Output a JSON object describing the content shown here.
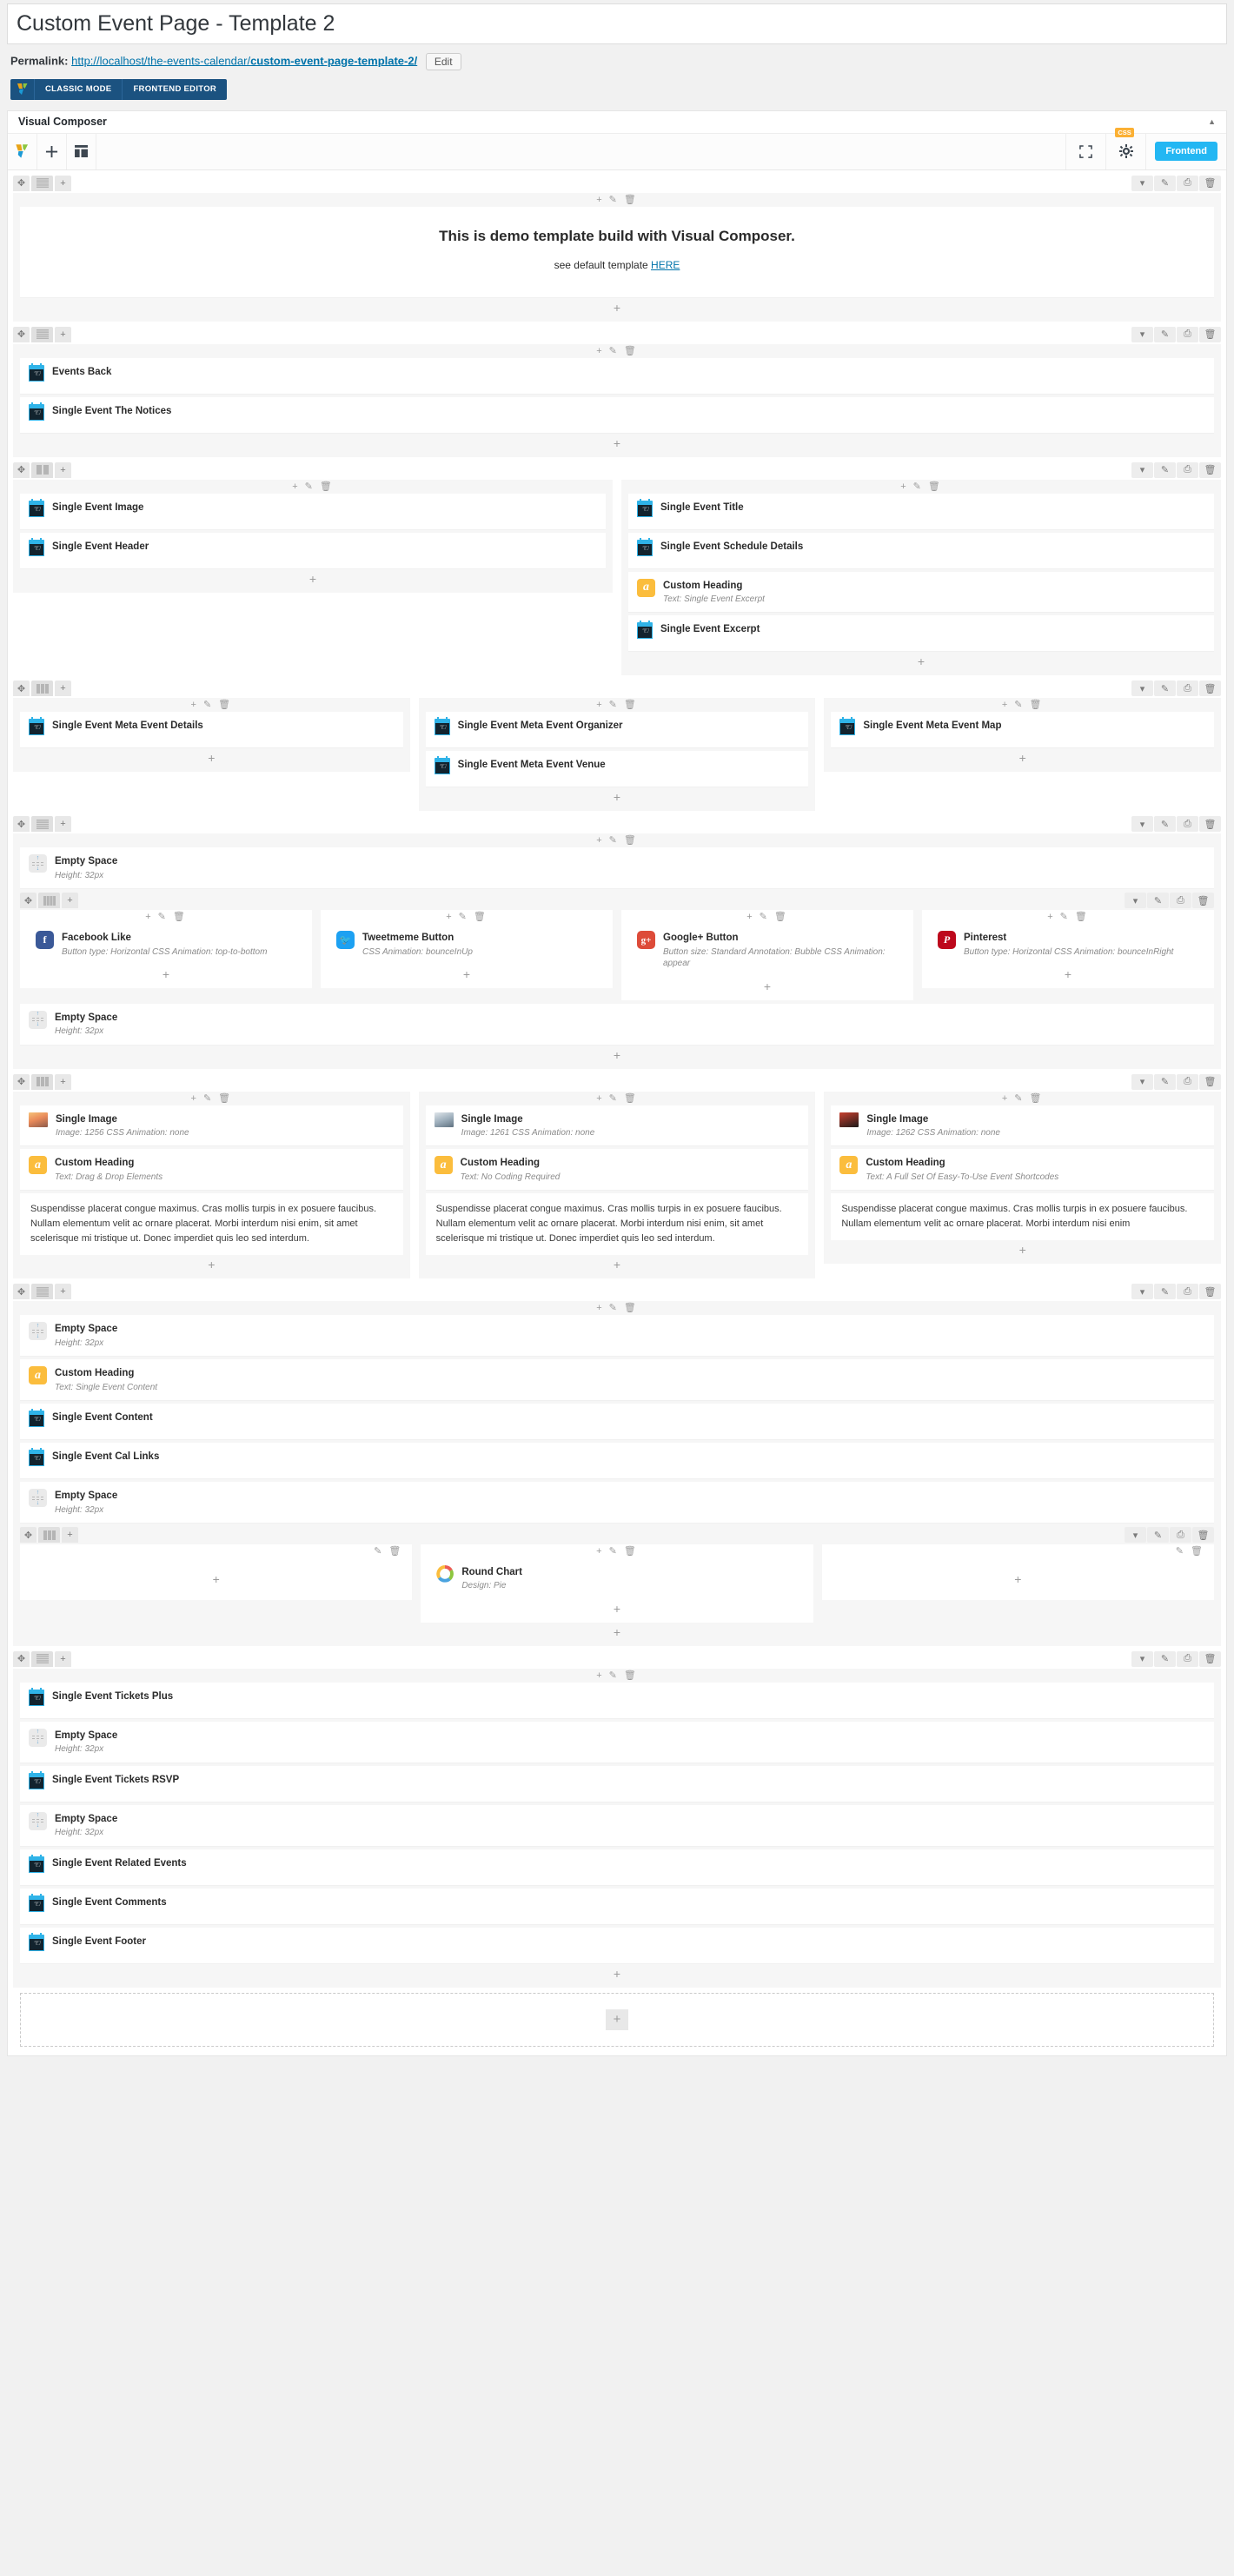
{
  "page": {
    "title": "Custom Event Page - Template 2",
    "permalink_label": "Permalink:",
    "permalink_base": "http://localhost/the-events-calendar/",
    "permalink_slug": "custom-event-page-template-2/",
    "edit_button": "Edit"
  },
  "modebar": {
    "classic": "CLASSIC MODE",
    "frontend": "FRONTEND EDITOR"
  },
  "vc": {
    "panel_title": "Visual Composer",
    "css_badge": "CSS",
    "frontend_button": "Frontend",
    "icons": {
      "logo": "visual-composer-logo-icon",
      "add": "plus-icon",
      "templates": "layout-templates-icon",
      "fullscreen": "fullscreen-icon",
      "settings": "gear-icon"
    }
  },
  "rows": [
    {
      "name": "row-intro",
      "layout": "1-column",
      "columns": [
        {
          "elements": [
            {
              "kind": "text",
              "heading": "This is demo template build with Visual Composer.",
              "sub_prefix": "see default template ",
              "link": "HERE"
            }
          ]
        }
      ]
    },
    {
      "name": "row-events-back",
      "layout": "1-column",
      "columns": [
        {
          "elements": [
            {
              "kind": "calendar",
              "title": "Events Back",
              "sub": ""
            },
            {
              "kind": "calendar",
              "title": "Single Event The Notices",
              "sub": ""
            }
          ]
        }
      ]
    },
    {
      "name": "row-image-title",
      "layout": "2-column",
      "columns": [
        {
          "elements": [
            {
              "kind": "calendar",
              "title": "Single Event Image",
              "sub": ""
            },
            {
              "kind": "calendar",
              "title": "Single Event Header",
              "sub": ""
            }
          ]
        },
        {
          "elements": [
            {
              "kind": "calendar",
              "title": "Single Event Title",
              "sub": ""
            },
            {
              "kind": "calendar",
              "title": "Single Event Schedule Details",
              "sub": ""
            },
            {
              "kind": "heading",
              "title": "Custom Heading",
              "sub": "Text: Single Event Excerpt"
            },
            {
              "kind": "calendar",
              "title": "Single Event Excerpt",
              "sub": ""
            }
          ]
        }
      ]
    },
    {
      "name": "row-meta",
      "layout": "3-column",
      "columns": [
        {
          "elements": [
            {
              "kind": "calendar",
              "title": "Single Event Meta Event Details",
              "sub": ""
            }
          ]
        },
        {
          "elements": [
            {
              "kind": "calendar",
              "title": "Single Event Meta Event Organizer",
              "sub": ""
            },
            {
              "kind": "calendar",
              "title": "Single Event Meta Event Venue",
              "sub": ""
            }
          ]
        },
        {
          "elements": [
            {
              "kind": "calendar",
              "title": "Single Event Meta Event Map",
              "sub": ""
            }
          ]
        }
      ]
    },
    {
      "name": "row-social",
      "layout": "1-column-nested",
      "top_elements": [
        {
          "kind": "space",
          "title": "Empty Space",
          "sub": "Height: 32px"
        }
      ],
      "nested_columns": [
        {
          "elements": [
            {
              "kind": "facebook",
              "title": "Facebook Like",
              "sub": "Button type: Horizontal  CSS Animation: top-to-bottom"
            }
          ]
        },
        {
          "elements": [
            {
              "kind": "twitter",
              "title": "Tweetmeme Button",
              "sub": "CSS Animation: bounceInUp"
            }
          ]
        },
        {
          "elements": [
            {
              "kind": "googleplus",
              "title": "Google+ Button",
              "sub": "Button size: Standard  Annotation: Bubble  CSS Animation: appear"
            }
          ]
        },
        {
          "elements": [
            {
              "kind": "pinterest",
              "title": "Pinterest",
              "sub": "Button type: Horizontal  CSS Animation: bounceInRight"
            }
          ]
        }
      ],
      "bottom_elements": [
        {
          "kind": "space",
          "title": "Empty Space",
          "sub": "Height: 32px"
        }
      ]
    },
    {
      "name": "row-features",
      "layout": "3-column",
      "columns": [
        {
          "elements": [
            {
              "kind": "image-a",
              "title": "Single Image",
              "sub": "Image: 1256  CSS Animation: none"
            },
            {
              "kind": "heading",
              "title": "Custom Heading",
              "sub": "Text: Drag & Drop Elements"
            },
            {
              "kind": "paragraph",
              "text": "Suspendisse placerat congue maximus. Cras mollis turpis in ex posuere faucibus. Nullam elementum velit ac ornare placerat. Morbi interdum nisi enim, sit amet scelerisque mi tristique ut. Donec imperdiet quis leo sed interdum."
            }
          ]
        },
        {
          "elements": [
            {
              "kind": "image-b",
              "title": "Single Image",
              "sub": "Image: 1261  CSS Animation: none"
            },
            {
              "kind": "heading",
              "title": "Custom Heading",
              "sub": "Text: No Coding Required"
            },
            {
              "kind": "paragraph",
              "text": "Suspendisse placerat congue maximus. Cras mollis turpis in ex posuere faucibus. Nullam elementum velit ac ornare placerat. Morbi interdum nisi enim, sit amet scelerisque mi tristique ut. Donec imperdiet quis leo sed interdum."
            }
          ]
        },
        {
          "elements": [
            {
              "kind": "image-c",
              "title": "Single Image",
              "sub": "Image: 1262  CSS Animation: none"
            },
            {
              "kind": "heading",
              "title": "Custom Heading",
              "sub": "Text: A Full Set Of Easy-To-Use Event Shortcodes"
            },
            {
              "kind": "paragraph",
              "text": "Suspendisse placerat congue maximus. Cras mollis turpis in ex posuere faucibus. Nullam elementum velit ac ornare placerat. Morbi interdum nisi enim"
            }
          ]
        }
      ]
    },
    {
      "name": "row-content",
      "layout": "1-column-nested",
      "top_elements": [
        {
          "kind": "space",
          "title": "Empty Space",
          "sub": "Height: 32px"
        },
        {
          "kind": "heading",
          "title": "Custom Heading",
          "sub": "Text: Single Event Content"
        },
        {
          "kind": "calendar",
          "title": "Single Event Content",
          "sub": ""
        },
        {
          "kind": "calendar",
          "title": "Single Event Cal Links",
          "sub": ""
        },
        {
          "kind": "space",
          "title": "Empty Space",
          "sub": "Height: 32px"
        }
      ],
      "nested_columns": [
        {
          "elements": []
        },
        {
          "elements": [
            {
              "kind": "chart",
              "title": "Round Chart",
              "sub": "Design: Pie"
            }
          ]
        },
        {
          "elements": []
        }
      ],
      "bottom_elements": []
    },
    {
      "name": "row-tickets",
      "layout": "1-column",
      "columns": [
        {
          "elements": [
            {
              "kind": "calendar",
              "title": "Single Event Tickets Plus",
              "sub": ""
            },
            {
              "kind": "space",
              "title": "Empty Space",
              "sub": "Height: 32px"
            },
            {
              "kind": "calendar",
              "title": "Single Event Tickets RSVP",
              "sub": ""
            },
            {
              "kind": "space",
              "title": "Empty Space",
              "sub": "Height: 32px"
            },
            {
              "kind": "calendar",
              "title": "Single Event Related Events",
              "sub": ""
            },
            {
              "kind": "calendar",
              "title": "Single Event Comments",
              "sub": ""
            },
            {
              "kind": "calendar",
              "title": "Single Event Footer",
              "sub": ""
            }
          ]
        }
      ]
    }
  ],
  "controls": {
    "plus": "+",
    "pencil": "✐",
    "trash": "trash-icon",
    "copy": "copy-icon",
    "caret": "▾",
    "move": "move-icon"
  }
}
